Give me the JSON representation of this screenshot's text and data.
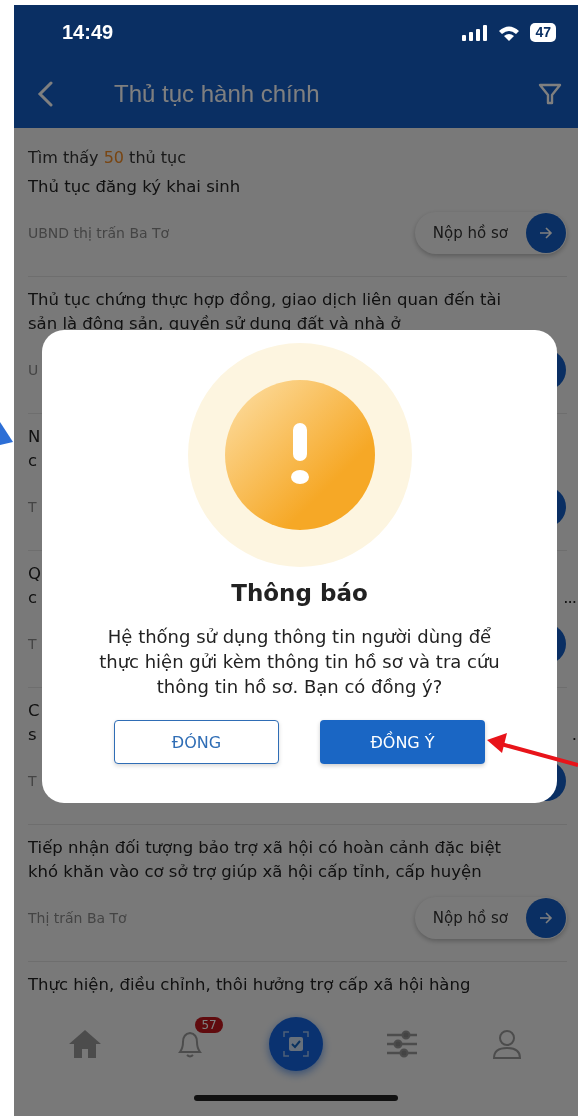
{
  "status_bar": {
    "time": "14:49",
    "battery": "47"
  },
  "header": {
    "title": "Thủ tục hành chính"
  },
  "result_count": {
    "prefix": "Tìm thấy",
    "count": "50",
    "suffix": "thủ tục"
  },
  "procedures": [
    {
      "kind": "full",
      "title_lines": [
        "Thủ tục đăng ký khai sinh"
      ],
      "agency": "UBND thị trấn Ba Tơ",
      "action": "Nộp hồ sơ"
    },
    {
      "kind": "covered",
      "title_lines": [
        "Thủ tục chứng thực hợp đồng, giao dịch liên quan đến tài",
        "sản là động sản, quyền sử dụng đất và nhà ở"
      ],
      "agency": "U"
    },
    {
      "kind": "covered",
      "title_lines": [
        "N",
        "c"
      ],
      "agency": "T"
    },
    {
      "kind": "covered",
      "title_lines": [
        "Q",
        "c"
      ],
      "title_end": "...",
      "agency": "T"
    },
    {
      "kind": "covered",
      "title_lines": [
        "C",
        "s"
      ],
      "title_end": ".",
      "agency": "T"
    },
    {
      "kind": "full",
      "title_lines": [
        "Tiếp nhận đối tượng bảo trợ xã hội có hoàn cảnh đặc biệt",
        "khó khăn vào cơ sở trợ giúp xã hội cấp tỉnh, cấp huyện"
      ],
      "agency": "Thị trấn Ba Tơ",
      "action": "Nộp hồ sơ"
    },
    {
      "kind": "cut",
      "title_lines": [
        "Thực hiện, điều chỉnh, thôi hưởng trợ cấp xã hội hàng"
      ]
    }
  ],
  "bottom_nav": [
    {
      "kind": "home"
    },
    {
      "kind": "bell",
      "badge": "57"
    },
    {
      "kind": "scan"
    },
    {
      "kind": "sliders"
    },
    {
      "kind": "person"
    }
  ],
  "dialog": {
    "title": "Thông báo",
    "message": "Hệ thống sử dụng thông tin người dùng để thực hiện gửi kèm thông tin hồ sơ và tra cứu thông tin hồ sơ. Bạn có đồng ý?",
    "buttons": [
      {
        "label": "ĐÓNG",
        "kind": "outline"
      },
      {
        "label": "ĐỒNG Ý",
        "kind": "filled"
      }
    ]
  },
  "annotations": [
    {
      "kind": "blue-arrow"
    },
    {
      "kind": "red-arrow"
    }
  ]
}
